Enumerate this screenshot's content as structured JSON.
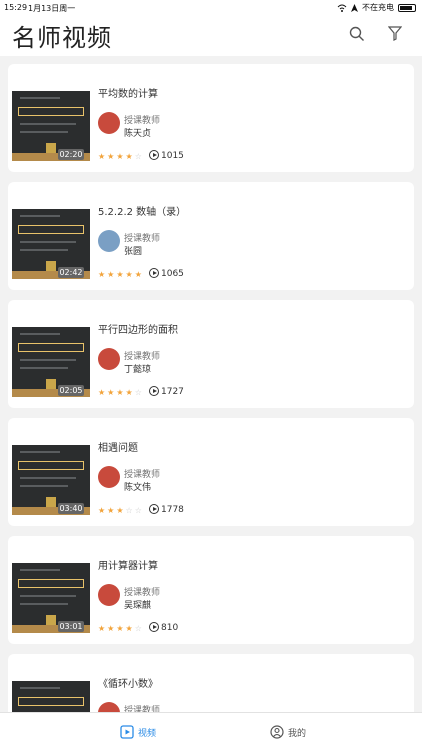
{
  "status_bar": {
    "time": "15:29",
    "date": "1月13日周一",
    "network": "不在充电"
  },
  "header": {
    "title": "名师视频"
  },
  "videos": [
    {
      "title": "平均数的计算",
      "duration": "02:20",
      "role": "授课教师",
      "teacher": "陈天贞",
      "views": "1015",
      "rating": 4,
      "avatar": "logo"
    },
    {
      "title": "5.2.2.2 数轴（录）",
      "duration": "02:42",
      "role": "授课教师",
      "teacher": "张圆",
      "views": "1065",
      "rating": 5,
      "avatar": "photo"
    },
    {
      "title": "平行四边形的面积",
      "duration": "02:05",
      "role": "授课教师",
      "teacher": "丁懿琼",
      "views": "1727",
      "rating": 4,
      "avatar": "logo"
    },
    {
      "title": "相遇问题",
      "duration": "03:40",
      "role": "授课教师",
      "teacher": "陈文伟",
      "views": "1778",
      "rating": 3,
      "avatar": "logo"
    },
    {
      "title": "用计算器计算",
      "duration": "03:01",
      "role": "授课教师",
      "teacher": "吴琛麒",
      "views": "810",
      "rating": 4,
      "avatar": "logo"
    },
    {
      "title": "《循环小数》",
      "duration": "",
      "role": "授课教师",
      "teacher": "",
      "views": "",
      "rating": 0,
      "avatar": "logo"
    }
  ],
  "tabbar": {
    "video": "视频",
    "mine": "我的"
  },
  "colors": {
    "accent": "#2a8be6",
    "star": "#f2a33a",
    "avatar_logo": "#c84a3c"
  }
}
